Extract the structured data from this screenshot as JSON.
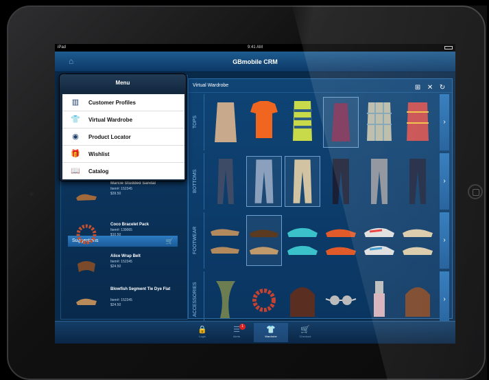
{
  "status": {
    "carrier": "iPad",
    "time": "9:41 AM"
  },
  "navbar": {
    "title": "GBmobile CRM"
  },
  "menu": {
    "title": "Menu",
    "items": [
      {
        "label": "Customer Profiles",
        "icon": "profiles-icon"
      },
      {
        "label": "Virtual Wardrobe",
        "icon": "shirt-icon"
      },
      {
        "label": "Product Locator",
        "icon": "locator-icon"
      },
      {
        "label": "Wishlist",
        "icon": "gift-icon"
      },
      {
        "label": "Catalog",
        "icon": "book-icon"
      }
    ]
  },
  "recent": [
    {
      "name": "Marcie Studded Sandal",
      "item": "Item#: 152345",
      "price": "$39.50"
    }
  ],
  "suggestions": {
    "title": "Suggestions",
    "items": [
      {
        "name": "Coco Bracelet Pack",
        "item": "Item#: 139065",
        "price": "$10.50"
      },
      {
        "name": "Alice Wrap Belt",
        "item": "Item#: 152345",
        "price": "$24.50"
      },
      {
        "name": "Blowfish Segment Tie Dye Flat",
        "item": "Item#: 152345",
        "price": "$24.50"
      }
    ]
  },
  "wardrobe": {
    "title": "Virtual Wardrobe",
    "rows": [
      {
        "label": "TOPS"
      },
      {
        "label": "BOTTOMS"
      },
      {
        "label": "FOOTWEAR"
      },
      {
        "label": "ACCESSORIES"
      }
    ]
  },
  "tabs": [
    {
      "label": "Login"
    },
    {
      "label": "Alerts",
      "badge": "1"
    },
    {
      "label": "Wardrobe"
    },
    {
      "label": "Checkout"
    }
  ]
}
